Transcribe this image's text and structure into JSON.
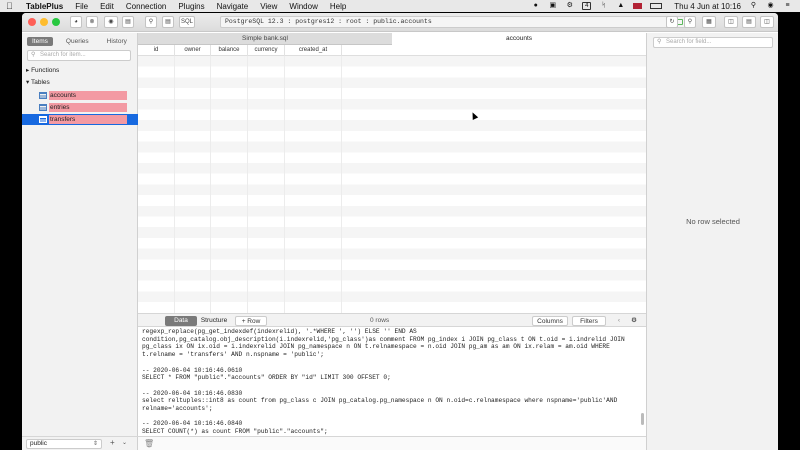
{
  "menubar": {
    "app_name": "TablePlus",
    "items": [
      "File",
      "Edit",
      "Connection",
      "Plugins",
      "Navigate",
      "View",
      "Window",
      "Help"
    ],
    "clock": "Thu 4 Jun at 10:16",
    "badge_number": "4"
  },
  "toolbar": {
    "sql_label": "SQL",
    "connection": "PostgreSQL 12.3 : postgres12 : root : public.accounts",
    "status_color": "#5cb85c"
  },
  "sidebar": {
    "tabs": [
      "Items",
      "Queries",
      "History"
    ],
    "active_tab": "Items",
    "search_placeholder": "Search for item...",
    "groups": [
      "Functions",
      "Tables"
    ],
    "tables": [
      "accounts",
      "entries",
      "transfers"
    ],
    "selected_table": "transfers",
    "schema": "public",
    "highlight_color": "#f39aa3",
    "selection_color": "#1769e0"
  },
  "editor_tabs": [
    "Simple bank.sql",
    "accounts"
  ],
  "active_editor_tab": "accounts",
  "grid": {
    "columns": [
      "id",
      "owner",
      "balance",
      "currency",
      "created_at"
    ],
    "row_count": "0 rows"
  },
  "grid_footer": {
    "data_label": "Data",
    "structure_label": "Structure",
    "add_row_label": "+ Row",
    "columns_label": "Columns",
    "filters_label": "Filters"
  },
  "console": {
    "text": "regexp_replace(pg_get_indexdef(indexrelid), '.*WHERE ', '') ELSE '' END AS\ncondition,pg_catalog.obj_description(i.indexrelid,'pg_class')as comment FROM pg_index i JOIN pg_class t ON t.oid = i.indrelid JOIN\npg_class ix ON ix.oid = i.indexrelid JOIN pg_namespace n ON t.relnamespace = n.oid JOIN pg_am as am ON ix.relam = am.oid WHERE\nt.relname = 'transfers' AND n.nspname = 'public';\n\n-- 2020-06-04 10:16:46.0610\nSELECT * FROM \"public\".\"accounts\" ORDER BY \"id\" LIMIT 300 OFFSET 0;\n\n-- 2020-06-04 10:16:46.0830\nselect reltuples::int8 as count from pg_class c JOIN pg_catalog.pg_namespace n ON n.oid=c.relnamespace where nspname='public'AND\nrelname='accounts';\n\n-- 2020-06-04 10:16:46.0840\nSELECT COUNT(*) as count FROM \"public\".\"accounts\";"
  },
  "right_panel": {
    "search_placeholder": "Search for field...",
    "empty_text": "No row selected"
  }
}
